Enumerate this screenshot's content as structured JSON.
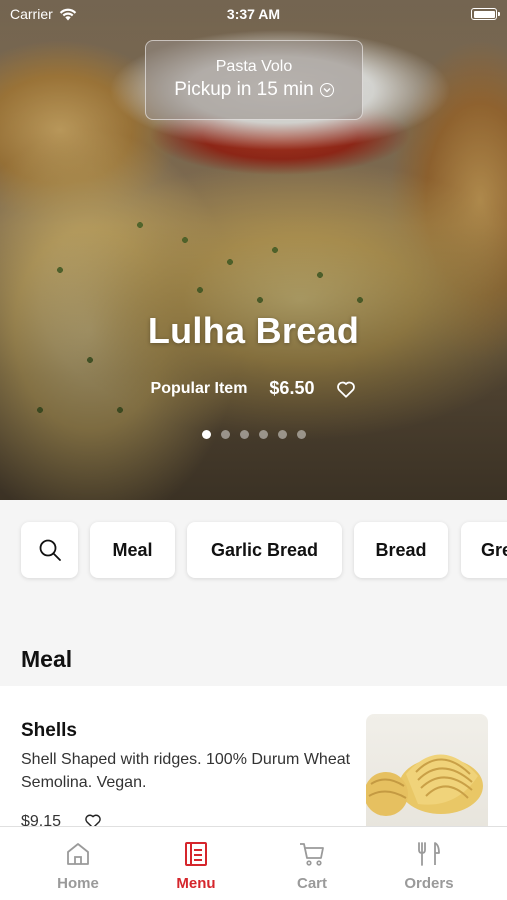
{
  "status_bar": {
    "carrier": "Carrier",
    "time": "3:37 AM"
  },
  "pickup": {
    "restaurant": "Pasta Volo",
    "time_label": "Pickup in 15 min"
  },
  "featured": {
    "title": "Lulha Bread",
    "tag": "Popular Item",
    "price": "$6.50",
    "slide_count": 6,
    "active_slide": 1
  },
  "categories": [
    "Meal",
    "Garlic Bread",
    "Bread",
    "Gre"
  ],
  "section": {
    "title": "Meal"
  },
  "menu_item": {
    "name": "Shells",
    "description": "Shell Shaped with ridges. 100% Durum Wheat Semolina. Vegan.",
    "price": "$9.15"
  },
  "tabs": [
    {
      "label": "Home",
      "icon": "home-icon",
      "active": false
    },
    {
      "label": "Menu",
      "icon": "menu-icon",
      "active": true
    },
    {
      "label": "Cart",
      "icon": "cart-icon",
      "active": false
    },
    {
      "label": "Orders",
      "icon": "orders-icon",
      "active": false
    }
  ],
  "colors": {
    "accent": "#d5262c",
    "inactive_tab": "#9a9a9a",
    "background": "#f5f5f5"
  }
}
